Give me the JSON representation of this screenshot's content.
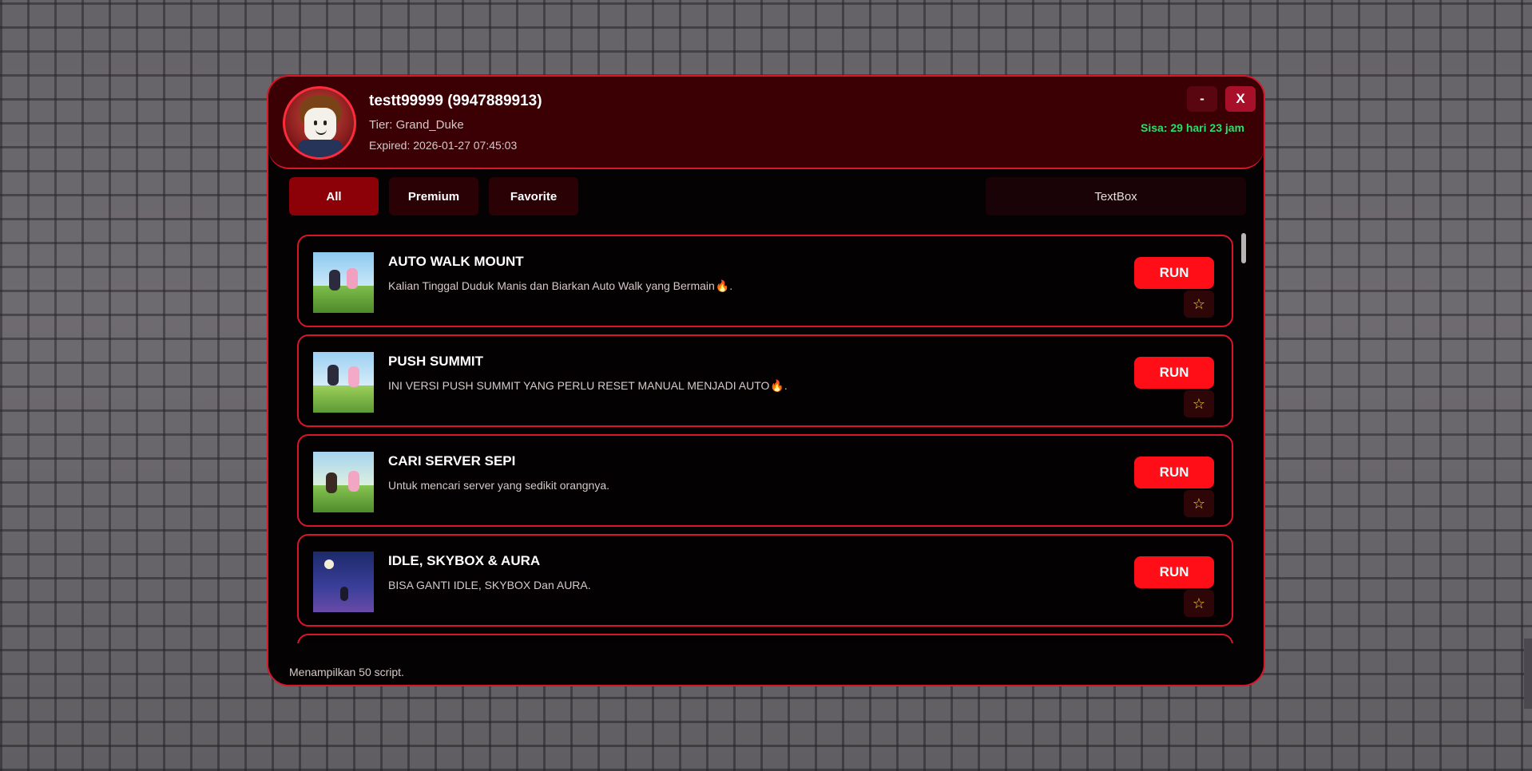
{
  "header": {
    "username": "testt99999 (9947889913)",
    "tier": "Tier: Grand_Duke",
    "expired": "Expired: 2026-01-27 07:45:03",
    "remaining": "Sisa: 29 hari 23 jam",
    "minimize_label": "-",
    "close_label": "X"
  },
  "tabs": [
    {
      "label": "All",
      "active": true
    },
    {
      "label": "Premium",
      "active": false
    },
    {
      "label": "Favorite",
      "active": false
    }
  ],
  "search": {
    "text": "TextBox"
  },
  "scripts": [
    {
      "title": "AUTO WALK MOUNT",
      "description": "Kalian Tinggal Duduk Manis dan Biarkan Auto Walk yang Bermain",
      "suffix_icon": "fire-icon",
      "suffix_end": ".",
      "run_label": "RUN",
      "thumbnail_icon": "kids-running-icon"
    },
    {
      "title": "PUSH SUMMIT",
      "description": "INI VERSI PUSH SUMMIT YANG PERLU RESET MANUAL MENJADI AUTO",
      "suffix_icon": "fire-icon",
      "suffix_end": ".",
      "run_label": "RUN",
      "thumbnail_icon": "kids-meadow-icon"
    },
    {
      "title": "CARI SERVER SEPI",
      "description": "Untuk mencari server yang sedikit orangnya.",
      "run_label": "RUN",
      "thumbnail_icon": "kids-wifi-icon"
    },
    {
      "title": "IDLE, SKYBOX & AURA",
      "description": "BISA GANTI IDLE, SKYBOX Dan AURA.",
      "run_label": "RUN",
      "thumbnail_icon": "night-sky-icon"
    }
  ],
  "footer": {
    "text": "Menampilkan 50 script."
  },
  "colors": {
    "accent": "#d9152a",
    "header_bg": "#3a0004",
    "run_button": "#ff0e18",
    "remaining_text": "#27e06a",
    "star": "#ffd42a"
  }
}
